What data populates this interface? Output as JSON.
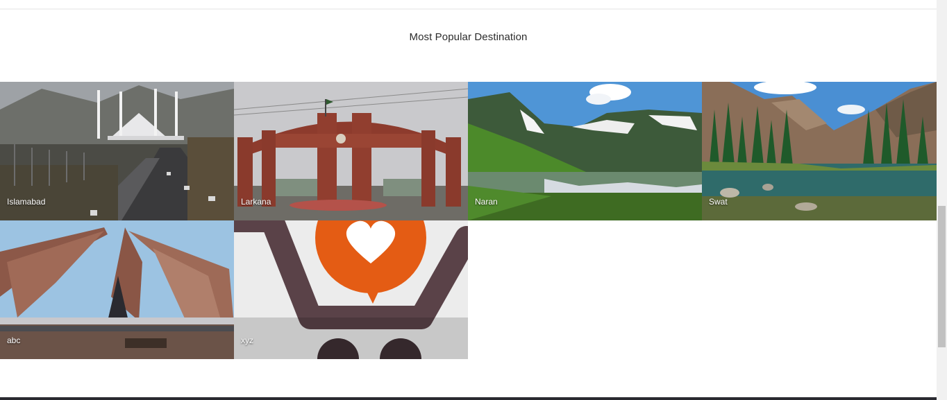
{
  "section": {
    "title": "Most Popular Destination"
  },
  "destinations": [
    {
      "name": "Islamabad"
    },
    {
      "name": "Larkana"
    },
    {
      "name": "Naran"
    },
    {
      "name": "Swat"
    },
    {
      "name": "abc"
    },
    {
      "name": "xyz"
    }
  ],
  "colors": {
    "background": "#ffffff",
    "title_text": "#2b2b2b",
    "label_text": "#ffffff",
    "footer": "#2a2a30",
    "scrollbar_track": "#f1f1f1",
    "scrollbar_thumb": "#c1c1c1"
  }
}
